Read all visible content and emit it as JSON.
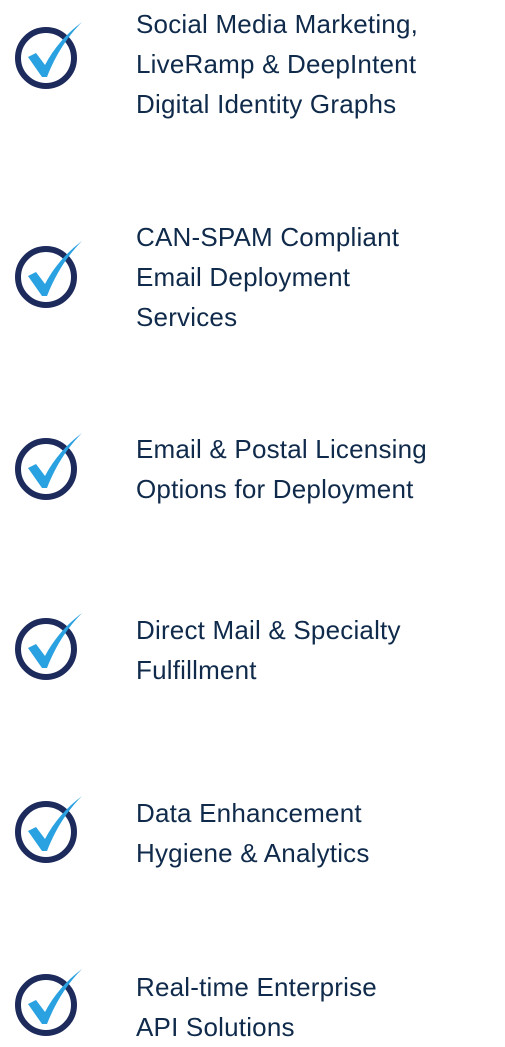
{
  "colors": {
    "text": "#0f2a4a",
    "circle": "#1d2a5c",
    "check": "#2aa1e0"
  },
  "features": [
    {
      "icon": "checkmark-circle-icon",
      "label": "Social Media Marketing,\nLiveRamp & DeepIntent\nDigital Identity Graphs"
    },
    {
      "icon": "checkmark-circle-icon",
      "label": "CAN-SPAM Compliant\nEmail Deployment\nServices"
    },
    {
      "icon": "checkmark-circle-icon",
      "label": "Email & Postal Licensing\nOptions for Deployment"
    },
    {
      "icon": "checkmark-circle-icon",
      "label": "Direct Mail & Specialty\nFulfillment"
    },
    {
      "icon": "checkmark-circle-icon",
      "label": "Data Enhancement\nHygiene & Analytics"
    },
    {
      "icon": "checkmark-circle-icon",
      "label": "Real-time Enterprise\nAPI Solutions"
    }
  ]
}
